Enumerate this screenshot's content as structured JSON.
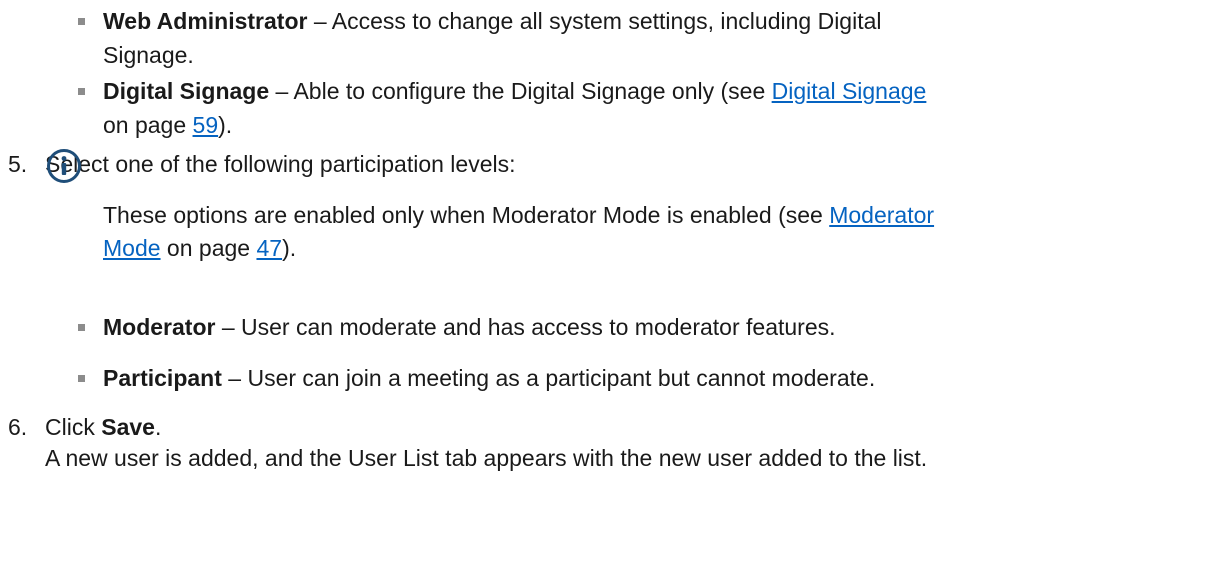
{
  "list_top": {
    "web_admin": {
      "term": "Web Administrator",
      "sep": " – ",
      "desc_line1": "Access to change all system settings, including Digital",
      "desc_line2": "Signage."
    },
    "digital_signage": {
      "term": "Digital Signage",
      "sep": " – ",
      "desc_pre": "Able to configure the Digital Signage only (see ",
      "link": "Digital Signage",
      "line2_pre": "on page ",
      "page": "59",
      "line2_post": ")."
    }
  },
  "step5": {
    "number": "5.",
    "text": "Select one of the following participation levels:"
  },
  "note": {
    "icon": "info-icon",
    "line1_pre": "These options are enabled only when Moderator Mode is enabled (see ",
    "link_part1": "Moderator",
    "link_part2": "Mode",
    "mid": " on page ",
    "page": "47",
    "post": ")."
  },
  "list_levels": {
    "moderator": {
      "term": "Moderator",
      "sep": " – ",
      "desc": "User can moderate and has access to moderator features."
    },
    "participant": {
      "term": "Participant",
      "sep": " – ",
      "desc": "User can join a meeting as a participant but cannot moderate."
    }
  },
  "step6": {
    "number": "6.",
    "pre": "Click ",
    "bold": "Save",
    "post": ".",
    "result": "A new user is added, and the User List tab appears with the new user added to the list."
  },
  "colors": {
    "text": "#1a1a1a",
    "link": "#0563c1",
    "bullet": "#8c8c8c",
    "icon": "#1f4e79"
  }
}
